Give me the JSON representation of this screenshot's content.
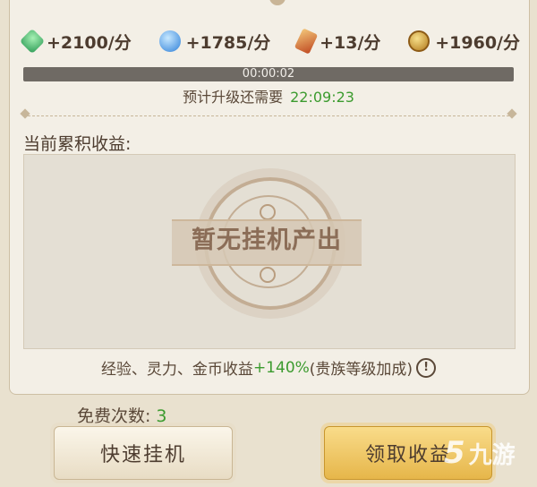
{
  "rates": [
    {
      "icon": "green-gem-icon",
      "text": "+2100/分"
    },
    {
      "icon": "blue-spirit-icon",
      "text": "+1785/分"
    },
    {
      "icon": "scroll-icon",
      "text": "+13/分"
    },
    {
      "icon": "gold-coin-icon",
      "text": "+1960/分"
    }
  ],
  "progress": {
    "time": "00:00:02",
    "fraction": 0.0
  },
  "eta": {
    "label": "预计升级还需要",
    "value": "22:09:23"
  },
  "section_title": "当前累积收益:",
  "empty_text": "暂无挂机产出",
  "bonus": {
    "prefix": "经验、灵力、金币收益",
    "pct": "+140%",
    "suffix": "(贵族等级加成)",
    "info": "!"
  },
  "free": {
    "label": "免费次数:",
    "count": "3"
  },
  "buttons": {
    "quick": "快速挂机",
    "claim": "领取收益"
  },
  "watermark": {
    "glyph": "5",
    "text": "九游"
  },
  "colors": {
    "accent_green": "#3c9b2f",
    "panel_bg": "#f3efe6",
    "claim_gold": "#e6b64a"
  }
}
